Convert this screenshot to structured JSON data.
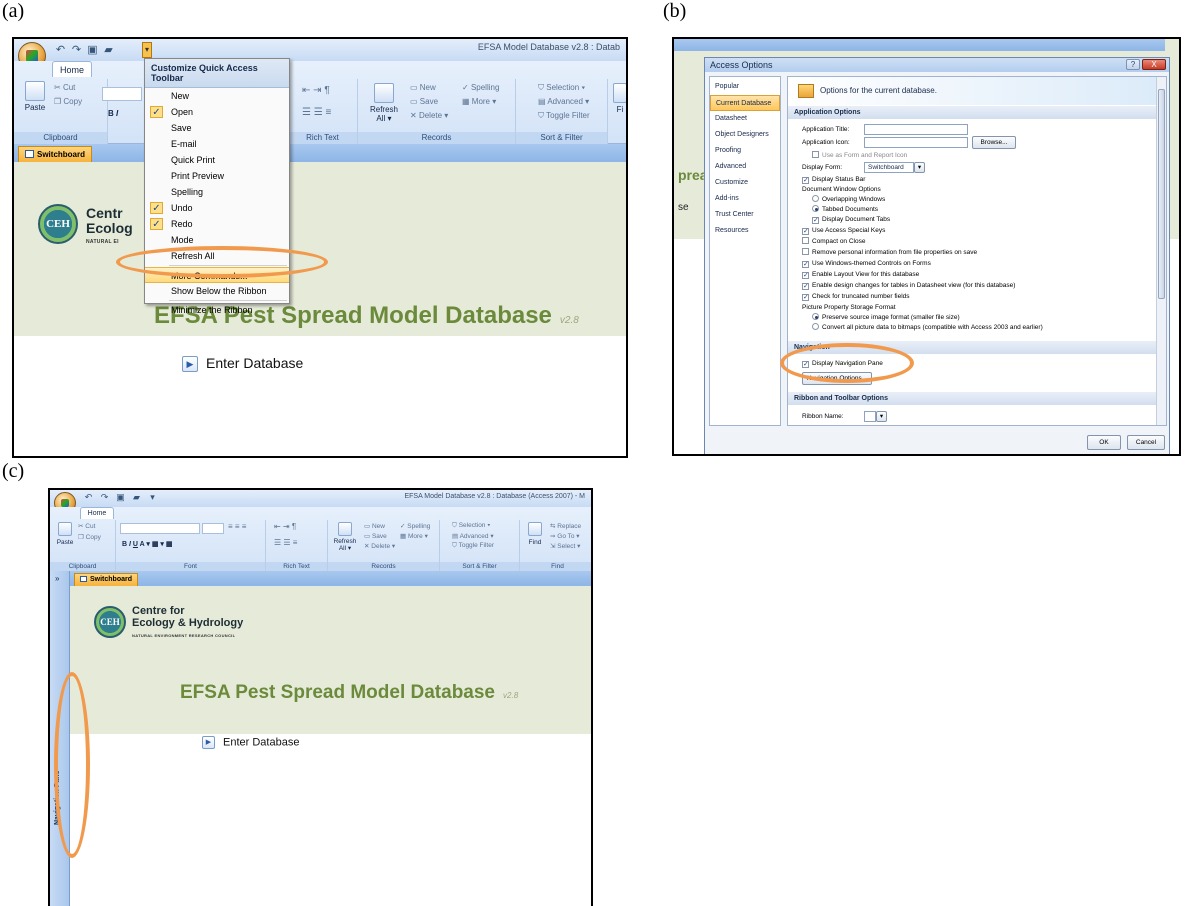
{
  "labels": {
    "a": "(a)",
    "b": "(b)",
    "c": "(c)"
  },
  "colors": {
    "highlight_ellipse": "#f19a4d",
    "db_title": "#6b8a3b",
    "office_tab": "#f6b23d",
    "ribbon": "#d3e3f7"
  },
  "panel_a": {
    "title": "EFSA Model Database v2.8 : Datab",
    "home_tab": "Home",
    "ribbon": {
      "cut": "Cut",
      "copy": "Copy",
      "paste": "Paste",
      "clipboard": "Clipboard",
      "rich_text": "Rich Text",
      "new": "New",
      "save": "Save",
      "delete": "Delete",
      "spelling": "Spelling",
      "more": "More",
      "refresh": "Refresh",
      "refresh_sub": "All",
      "records": "Records",
      "selection": "Selection",
      "advanced": "Advanced",
      "toggle_filter": "Toggle Filter",
      "sort_filter": "Sort & Filter",
      "find_partial": "Fi"
    },
    "doc_tab": "Switchboard",
    "menu": {
      "title": "Customize Quick Access Toolbar",
      "items": [
        {
          "label": "New",
          "checked": false
        },
        {
          "label": "Open",
          "checked": true
        },
        {
          "label": "Save",
          "checked": false
        },
        {
          "label": "E-mail",
          "checked": false
        },
        {
          "label": "Quick Print",
          "checked": false
        },
        {
          "label": "Print Preview",
          "checked": false
        },
        {
          "label": "Spelling",
          "checked": false
        },
        {
          "label": "Undo",
          "checked": true
        },
        {
          "label": "Redo",
          "checked": true
        },
        {
          "label": "Mode",
          "checked": false
        },
        {
          "label": "Refresh All",
          "checked": false
        }
      ],
      "more_commands": "More Commands...",
      "show_below": "Show Below the Ribbon",
      "minimize": "Minimize the Ribbon"
    },
    "logo_circle": "CEH",
    "logo_line1": "Centr",
    "logo_line2": "Ecolog",
    "logo_sub": "NATURAL EI",
    "db_title": "EFSA Pest Spread Model Database",
    "db_version": "v2.8",
    "enter": "Enter Database"
  },
  "panel_b": {
    "bg_fragment": "prea",
    "bg_fragment2": "se",
    "dialog_title": "Access Options",
    "help": "?",
    "close": "X",
    "nav_items": [
      "Popular",
      "Current Database",
      "Datasheet",
      "Object Designers",
      "Proofing",
      "Advanced",
      "Customize",
      "Add-ins",
      "Trust Center",
      "Resources"
    ],
    "banner": "Options for the current database.",
    "app_options_header": "Application Options",
    "app_title_label": "Application Title:",
    "app_icon_label": "Application Icon:",
    "browse": "Browse...",
    "use_as_form_icon": "Use as Form and Report Icon",
    "display_form_label": "Display Form:",
    "display_form_value": "Switchboard",
    "display_status_bar": "Display Status Bar",
    "doc_window_options": "Document Window Options",
    "overlapping": "Overlapping Windows",
    "tabbed": "Tabbed Documents",
    "display_doc_tabs": "Display Document Tabs",
    "special_keys": "Use Access Special Keys",
    "compact": "Compact on Close",
    "remove_personal": "Remove personal information from file properties on save",
    "windows_themed": "Use Windows-themed Controls on Forms",
    "layout_view": "Enable Layout View for this database",
    "design_changes": "Enable design changes for tables in Datasheet view (for this database)",
    "truncated": "Check for truncated number fields",
    "picture_storage": "Picture Property Storage Format",
    "preserve": "Preserve source image format (smaller file size)",
    "convert": "Convert all picture data to bitmaps (compatible with Access 2003 and earlier)",
    "navigation_header": "Navigation",
    "display_nav_pane": "Display Navigation Pane",
    "nav_options": "Navigation Options...",
    "ribbon_header": "Ribbon and Toolbar Options",
    "ribbon_name": "Ribbon Name:",
    "ok": "OK",
    "cancel": "Cancel"
  },
  "panel_c": {
    "title": "EFSA Model Database v2.8 : Database (Access 2007) - M",
    "home_tab": "Home",
    "ribbon": {
      "cut": "Cut",
      "copy": "Copy",
      "paste": "Paste",
      "clipboard": "Clipboard",
      "font": "Font",
      "rich_text": "Rich Text",
      "new": "New",
      "save": "Save",
      "delete": "Delete",
      "spelling": "Spelling",
      "more": "More",
      "refresh": "Refresh",
      "refresh_sub": "All",
      "records": "Records",
      "selection": "Selection",
      "advanced": "Advanced",
      "toggle_filter": "Toggle Filter",
      "sort_filter": "Sort & Filter",
      "find": "Find",
      "replace": "Replace",
      "goto": "Go To",
      "select": "Select",
      "find_group": "Find"
    },
    "nav_toggle": "»",
    "doc_tab": "Switchboard",
    "logo_circle": "CEH",
    "logo_line1": "Centre for",
    "logo_line2": "Ecology & Hydrology",
    "logo_sub": "NATURAL ENVIRONMENT RESEARCH COUNCIL",
    "db_title": "EFSA Pest Spread Model Database",
    "db_version": "v2.8",
    "enter": "Enter Database",
    "nav_pane": "Navigation Pane"
  }
}
